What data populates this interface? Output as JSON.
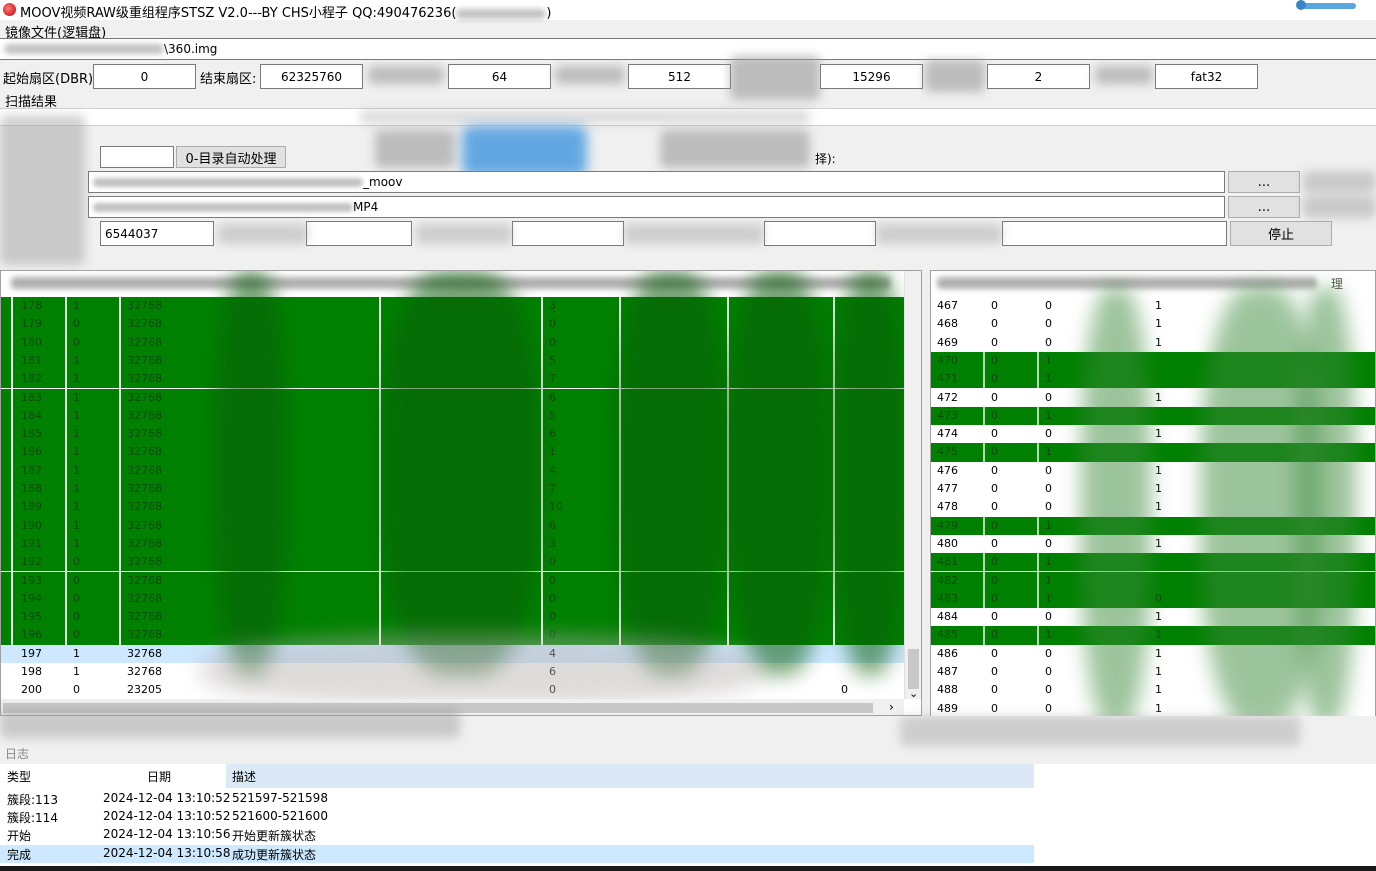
{
  "window": {
    "title": "MOOV视频RAW级重组程序STSZ V2.0---BY CHS小程子  QQ:490476236(",
    "title_tail": ")"
  },
  "image": {
    "label": "镜像文件(逻辑盘)",
    "path": "\\360.img"
  },
  "params": {
    "start_label": "起始扇区(DBR):",
    "start_value": "0",
    "end_label": "结束扇区:",
    "end_value": "62325760",
    "field3_value": "64",
    "field4_value": "512",
    "field5_value": "15296",
    "field6_value": "2",
    "fs_value": "fat32"
  },
  "scan": {
    "label": "扫描结果",
    "auto_button": "0-目录自动处理",
    "select_hint": "择):",
    "moov_path": "_moov",
    "mp4_path": "MP4",
    "browse1": "...",
    "browse2": "...",
    "counter_value": "6544037",
    "stop_button": "停止"
  },
  "left_table": {
    "rows": [
      {
        "c0": "178",
        "c1": "1",
        "c2": "32768",
        "c3": "3",
        "green": true
      },
      {
        "c0": "179",
        "c1": "0",
        "c2": "32768",
        "c3": "0",
        "green": true
      },
      {
        "c0": "180",
        "c1": "0",
        "c2": "32768",
        "c3": "0",
        "green": true
      },
      {
        "c0": "181",
        "c1": "1",
        "c2": "32768",
        "c3": "5",
        "green": true
      },
      {
        "c0": "182",
        "c1": "1",
        "c2": "32768",
        "c3": "7",
        "green": true
      },
      {
        "c0": "183",
        "c1": "1",
        "c2": "32768",
        "c3": "6",
        "green": true
      },
      {
        "c0": "184",
        "c1": "1",
        "c2": "32768",
        "c3": "5",
        "green": true
      },
      {
        "c0": "185",
        "c1": "1",
        "c2": "32768",
        "c3": "6",
        "green": true
      },
      {
        "c0": "186",
        "c1": "1",
        "c2": "32768",
        "c3": "1",
        "green": true
      },
      {
        "c0": "187",
        "c1": "1",
        "c2": "32768",
        "c3": "4",
        "green": true
      },
      {
        "c0": "188",
        "c1": "1",
        "c2": "32768",
        "c3": "7",
        "green": true
      },
      {
        "c0": "189",
        "c1": "1",
        "c2": "32768",
        "c3": "10",
        "green": true
      },
      {
        "c0": "190",
        "c1": "1",
        "c2": "32768",
        "c3": "6",
        "green": true
      },
      {
        "c0": "191",
        "c1": "1",
        "c2": "32768",
        "c3": "3",
        "green": true
      },
      {
        "c0": "192",
        "c1": "0",
        "c2": "32768",
        "c3": "0",
        "green": true
      },
      {
        "c0": "193",
        "c1": "0",
        "c2": "32768",
        "c3": "0",
        "green": true
      },
      {
        "c0": "194",
        "c1": "0",
        "c2": "32768",
        "c3": "0",
        "green": true
      },
      {
        "c0": "195",
        "c1": "0",
        "c2": "32768",
        "c3": "0",
        "green": true
      },
      {
        "c0": "196",
        "c1": "0",
        "c2": "32768",
        "c3": "0",
        "green": true
      },
      {
        "c0": "197",
        "c1": "1",
        "c2": "32768",
        "c3": "4",
        "green": false,
        "sel": true
      },
      {
        "c0": "198",
        "c1": "1",
        "c2": "32768",
        "c3": "6",
        "green": false
      },
      {
        "c0": "200",
        "c1": "0",
        "c2": "23205",
        "c3": "0",
        "green": false,
        "c5": "0"
      }
    ]
  },
  "right_table": {
    "rows": [
      {
        "c0": "467",
        "c1": "0",
        "c2": "0",
        "c3": "1",
        "green": false
      },
      {
        "c0": "468",
        "c1": "0",
        "c2": "0",
        "c3": "1",
        "green": false
      },
      {
        "c0": "469",
        "c1": "0",
        "c2": "0",
        "c3": "1",
        "green": false
      },
      {
        "c0": "470",
        "c1": "0",
        "c2": "1",
        "c3": "",
        "green": true
      },
      {
        "c0": "471",
        "c1": "0",
        "c2": "1",
        "c3": "",
        "green": true
      },
      {
        "c0": "472",
        "c1": "0",
        "c2": "0",
        "c3": "1",
        "green": false
      },
      {
        "c0": "473",
        "c1": "0",
        "c2": "1",
        "c3": "",
        "green": true
      },
      {
        "c0": "474",
        "c1": "0",
        "c2": "0",
        "c3": "1",
        "green": false
      },
      {
        "c0": "475",
        "c1": "0",
        "c2": "1",
        "c3": "",
        "green": true
      },
      {
        "c0": "476",
        "c1": "0",
        "c2": "0",
        "c3": "1",
        "green": false
      },
      {
        "c0": "477",
        "c1": "0",
        "c2": "0",
        "c3": "1",
        "green": false
      },
      {
        "c0": "478",
        "c1": "0",
        "c2": "0",
        "c3": "1",
        "green": false
      },
      {
        "c0": "479",
        "c1": "0",
        "c2": "1",
        "c3": "",
        "green": true
      },
      {
        "c0": "480",
        "c1": "0",
        "c2": "0",
        "c3": "1",
        "green": false
      },
      {
        "c0": "481",
        "c1": "0",
        "c2": "1",
        "c3": "",
        "green": true
      },
      {
        "c0": "482",
        "c1": "0",
        "c2": "1",
        "c3": "",
        "green": true
      },
      {
        "c0": "483",
        "c1": "0",
        "c2": "1",
        "c3": "0",
        "green": true
      },
      {
        "c0": "484",
        "c1": "0",
        "c2": "0",
        "c3": "1",
        "green": false
      },
      {
        "c0": "485",
        "c1": "0",
        "c2": "1",
        "c3": "1",
        "green": true
      },
      {
        "c0": "486",
        "c1": "0",
        "c2": "0",
        "c3": "1",
        "green": false
      },
      {
        "c0": "487",
        "c1": "0",
        "c2": "0",
        "c3": "1",
        "green": false
      },
      {
        "c0": "488",
        "c1": "0",
        "c2": "0",
        "c3": "1",
        "green": false
      },
      {
        "c0": "489",
        "c1": "0",
        "c2": "0",
        "c3": "1",
        "green": false
      }
    ],
    "header_tail": "理"
  },
  "log": {
    "section_label": "日志",
    "headers": {
      "type": "类型",
      "date": "日期",
      "desc": "描述"
    },
    "rows": [
      {
        "type": "簇段:113",
        "date": "2024-12-04 13:10:52",
        "desc": "521597-521598"
      },
      {
        "type": "簇段:114",
        "date": "2024-12-04 13:10:52",
        "desc": "521600-521600"
      },
      {
        "type": "开始",
        "date": "2024-12-04 13:10:56",
        "desc": "开始更新簇状态"
      },
      {
        "type": "完成",
        "date": "2024-12-04 13:10:58",
        "desc": "成功更新簇状态"
      }
    ]
  },
  "colors": {
    "green_row": "#008000",
    "selected_row": "#cde8ff",
    "highlight_blue": "#4a9be0"
  },
  "icons": {
    "app_icon": "red-circle-app-icon",
    "scroll_down": "chevron-down-icon",
    "scroll_right": "chevron-right-icon"
  }
}
